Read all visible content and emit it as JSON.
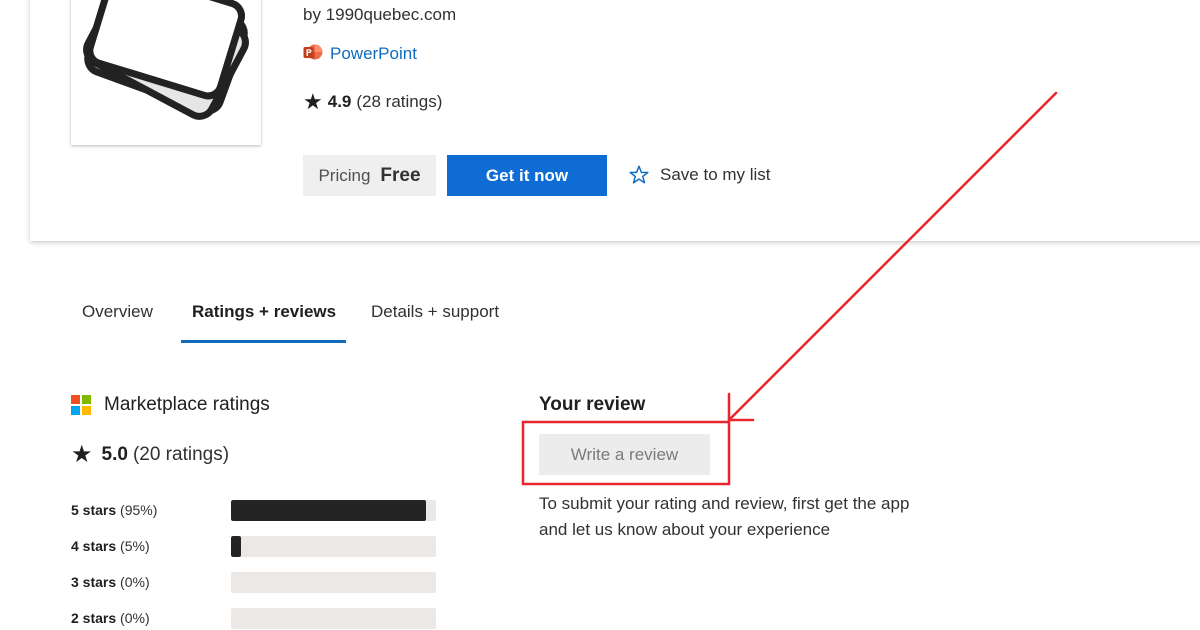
{
  "app": {
    "publisher": "by 1990quebec.com",
    "product_name": "PowerPoint",
    "rating_value": "4.9",
    "rating_count": "(28 ratings)",
    "pricing_label": "Pricing",
    "pricing_value": "Free",
    "get_button_label": "Get it now",
    "save_label": "Save to my list"
  },
  "tabs": [
    {
      "label": "Overview",
      "active": false
    },
    {
      "label": "Ratings + reviews",
      "active": true
    },
    {
      "label": "Details + support",
      "active": false
    }
  ],
  "marketplace_ratings": {
    "title": "Marketplace ratings",
    "overall_value": "5.0",
    "overall_count": "(20 ratings)",
    "breakdown": [
      {
        "stars_label": "5 stars",
        "percent_label": "(95%)",
        "fraction": 0.95
      },
      {
        "stars_label": "4 stars",
        "percent_label": "(5%)",
        "fraction": 0.05
      },
      {
        "stars_label": "3 stars",
        "percent_label": "(0%)",
        "fraction": 0.0
      },
      {
        "stars_label": "2 stars",
        "percent_label": "(0%)",
        "fraction": 0.0
      }
    ]
  },
  "your_review": {
    "title": "Your review",
    "write_button_label": "Write a review",
    "hint": "To submit your rating and review, first get the app and let us know about your experience"
  },
  "icons": {
    "rating_star": "star-icon",
    "save_star": "star-outline-icon",
    "product": "powerpoint-icon",
    "brand": "microsoft-logo-icon"
  },
  "colors": {
    "accent": "#0f6cd4",
    "link": "#0f6cbd",
    "annotation": "#e8262b",
    "bar_fill": "#242424",
    "bar_track": "#ebe8e5"
  }
}
